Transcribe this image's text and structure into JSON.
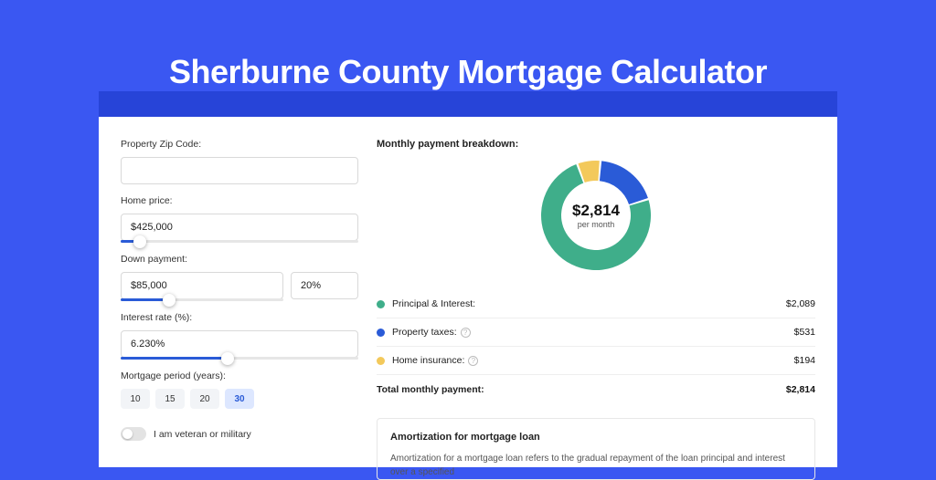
{
  "page_title": "Sherburne County Mortgage Calculator",
  "form": {
    "zip_label": "Property Zip Code:",
    "zip_value": "",
    "home_price_label": "Home price:",
    "home_price_value": "$425,000",
    "home_price_slider_pct": 8,
    "down_payment_label": "Down payment:",
    "down_payment_value": "$85,000",
    "down_payment_pct_value": "20%",
    "down_payment_slider_pct": 30,
    "interest_label": "Interest rate (%):",
    "interest_value": "6.230%",
    "interest_slider_pct": 45,
    "period_label": "Mortgage period (years):",
    "periods": [
      "10",
      "15",
      "20",
      "30"
    ],
    "period_active": "30",
    "veteran_label": "I am veteran or military",
    "veteran_on": false
  },
  "breakdown": {
    "title": "Monthly payment breakdown:",
    "amount": "$2,814",
    "sub": "per month",
    "items": [
      {
        "label": "Principal & Interest:",
        "value": "$2,089",
        "color": "#3fae8a",
        "has_info": false
      },
      {
        "label": "Property taxes:",
        "value": "$531",
        "color": "#2a5bd7",
        "has_info": true
      },
      {
        "label": "Home insurance:",
        "value": "$194",
        "color": "#f3c95b",
        "has_info": true
      }
    ],
    "total_label": "Total monthly payment:",
    "total_value": "$2,814"
  },
  "chart_data": {
    "type": "pie",
    "title": "Monthly payment breakdown",
    "series": [
      {
        "name": "Principal & Interest",
        "value": 2089,
        "color": "#3fae8a"
      },
      {
        "name": "Property taxes",
        "value": 531,
        "color": "#2a5bd7"
      },
      {
        "name": "Home insurance",
        "value": 194,
        "color": "#f3c95b"
      }
    ],
    "total": 2814,
    "center_label": "$2,814",
    "center_sub": "per month"
  },
  "amortization": {
    "title": "Amortization for mortgage loan",
    "text": "Amortization for a mortgage loan refers to the gradual repayment of the loan principal and interest over a specified"
  }
}
